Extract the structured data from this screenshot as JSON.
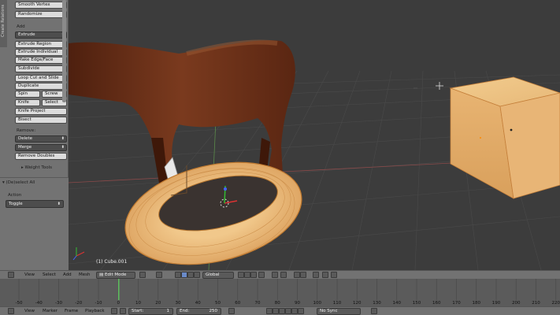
{
  "toolshelf": {
    "tab_label": "Create Relations",
    "buttons_top": [
      "Smooth Vertex",
      "Randomize"
    ],
    "add_label": "Add",
    "extrude_dropdown": "Extrude",
    "add_buttons": [
      "Extrude Region",
      "Extrude Individual",
      "Make Edge/Face",
      "Subdivide",
      "Loop Cut and Slide",
      "Duplicate"
    ],
    "spin": "Spin",
    "screw": "Screw",
    "knife": "Knife",
    "select": "Select",
    "knife_project": "Knife Project",
    "bisect": "Bisect",
    "remove_label": "Remove:",
    "delete_dropdown": "Delete",
    "merge_dropdown": "Merge",
    "remove_doubles": "Remove Doubles",
    "weight_tools": "Weight Tools"
  },
  "operator_panel": {
    "title": "(De)select All",
    "action_label": "Action",
    "action_value": "Toggle"
  },
  "viewport": {
    "object_name": "(1) Cube.001"
  },
  "view3d_header": {
    "menus": [
      "View",
      "Select",
      "Add",
      "Mesh"
    ],
    "mode": "Edit Mode",
    "orientation": "Global"
  },
  "timeline": {
    "ticks": [
      "-50",
      "-40",
      "-30",
      "-20",
      "-10",
      "0",
      "10",
      "20",
      "30",
      "40",
      "50",
      "60",
      "70",
      "80",
      "90",
      "100",
      "110",
      "120",
      "130",
      "140",
      "150",
      "160",
      "170",
      "180",
      "190",
      "200",
      "210",
      "220"
    ],
    "current_frame": 0
  },
  "timeline_header": {
    "menus": [
      "View",
      "Marker",
      "Frame",
      "Playback"
    ],
    "start": "Start:",
    "start_value": "1",
    "end": "End:",
    "end_value": "250",
    "sync": "No Sync"
  },
  "colors": {
    "viewport_bg": "#3c3c3c",
    "mesh_orange": "#e8b26a",
    "horse_brown": "#6a3018",
    "timeline_green": "#5cbf5c"
  }
}
